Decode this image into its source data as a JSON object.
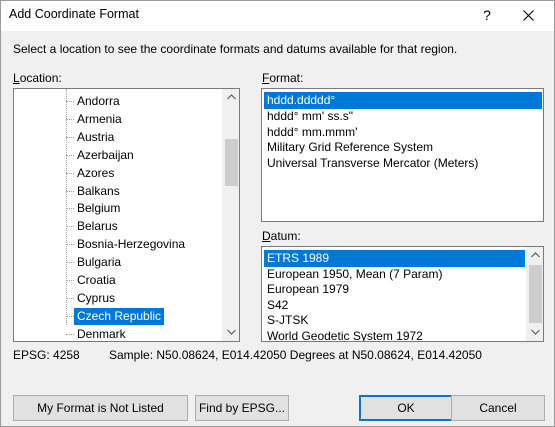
{
  "window": {
    "title": "Add Coordinate Format",
    "help_label": "?"
  },
  "instruction": "Select a location to see the coordinate formats and datums available for that region.",
  "location": {
    "label_prefix": "",
    "label_underlined": "L",
    "label_rest": "ocation:",
    "items": [
      "Andorra",
      "Armenia",
      "Austria",
      "Azerbaijan",
      "Azores",
      "Balkans",
      "Belgium",
      "Belarus",
      "Bosnia-Herzegovina",
      "Bulgaria",
      "Croatia",
      "Cyprus",
      "Czech Republic",
      "Denmark"
    ],
    "selected": "Czech Republic"
  },
  "format": {
    "label_underlined": "F",
    "label_rest": "ormat:",
    "items": [
      "hddd.ddddd°",
      "hddd° mm' ss.s\"",
      "hddd° mm.mmm'",
      "Military Grid Reference System",
      "Universal Transverse Mercator (Meters)"
    ],
    "selected": "hddd.ddddd°"
  },
  "datum": {
    "label_underlined": "D",
    "label_rest": "atum:",
    "items": [
      "ETRS 1989",
      "European 1950, Mean (7 Param)",
      "European 1979",
      "S42",
      "S-JTSK",
      "World Geodetic System 1972"
    ],
    "selected": "ETRS 1989"
  },
  "status": {
    "epsg": "EPSG: 4258",
    "sample": "Sample: N50.08624, E014.42050 Degrees at N50.08624, E014.42050"
  },
  "buttons": {
    "not_listed": "My Format is Not Listed",
    "find_epsg": "Find by EPSG...",
    "ok": "OK",
    "cancel": "Cancel"
  },
  "colors": {
    "selection": "#0078d7",
    "dialog_bg": "#f0f0f0",
    "button_bg": "#e1e1e1"
  }
}
